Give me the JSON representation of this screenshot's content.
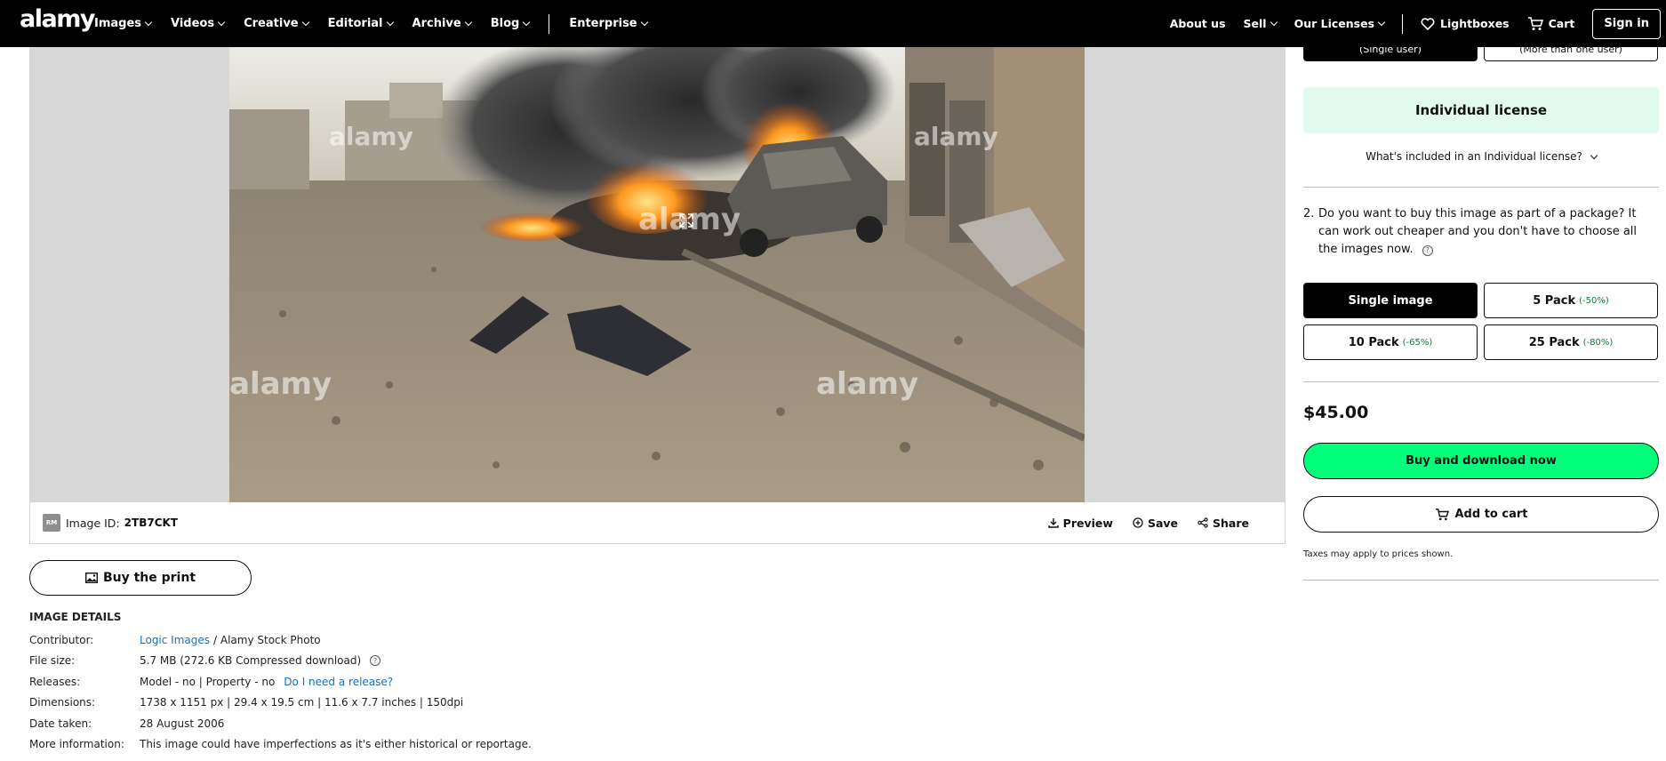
{
  "brand": {
    "logo": "alamy"
  },
  "nav": {
    "left": [
      {
        "label": "Images"
      },
      {
        "label": "Videos"
      },
      {
        "label": "Creative"
      },
      {
        "label": "Editorial"
      },
      {
        "label": "Archive"
      },
      {
        "label": "Blog"
      },
      {
        "label": "Enterprise"
      }
    ],
    "right": {
      "about": "About us",
      "sell": "Sell",
      "licenses": "Our Licenses",
      "lightboxes": "Lightboxes",
      "cart": "Cart",
      "signin": "Sign in"
    }
  },
  "image": {
    "watermark": "alamy",
    "badge": "RM",
    "id_label": "Image ID:",
    "id_value": "2TB7CKT",
    "actions": {
      "preview": "Preview",
      "save": "Save",
      "share": "Share"
    },
    "buy_print": "Buy the print"
  },
  "details": {
    "title": "IMAGE DETAILS",
    "contributor_label": "Contributor:",
    "contributor_link": "Logic Images",
    "contributor_rest": "/ Alamy Stock Photo",
    "filesize_label": "File size:",
    "filesize_value": "5.7 MB (272.6 KB Compressed download)",
    "releases_label": "Releases:",
    "releases_value": "Model - no | Property - no",
    "releases_link": "Do I need a release?",
    "dimensions_label": "Dimensions:",
    "dimensions_value": "1738 x 1151 px | 29.4 x 19.5 cm | 11.6 x 7.7 inches | 150dpi",
    "date_label": "Date taken:",
    "date_value": "28 August 2006",
    "more_label": "More information:",
    "more_value": "This image could have imperfections as it's either historical or reportage."
  },
  "panel": {
    "top_left": "(Single user)",
    "top_right": "(More than one user)",
    "license_title": "Individual license",
    "whats_included": "What's included in an Individual license?",
    "q2_num": "2.",
    "q2_text": "Do you want to buy this image as part of a package? It can work out cheaper and you don't have to choose all the images now.",
    "packs": {
      "single": "Single image",
      "p5": "5 Pack",
      "p5_disc": "(-50%)",
      "p10": "10 Pack",
      "p10_disc": "(-65%)",
      "p25": "25 Pack",
      "p25_disc": "(-80%)"
    },
    "price": "$45.00",
    "buy_now": "Buy and download now",
    "add_cart": "Add to cart",
    "taxes": "Taxes may apply to prices shown."
  },
  "colors": {
    "nav_bg": "#000000",
    "license_bg": "#e1fbee",
    "buy_now_bg": "#00ff7b",
    "link": "#1a6fb5",
    "discount": "#0a7d3c"
  }
}
